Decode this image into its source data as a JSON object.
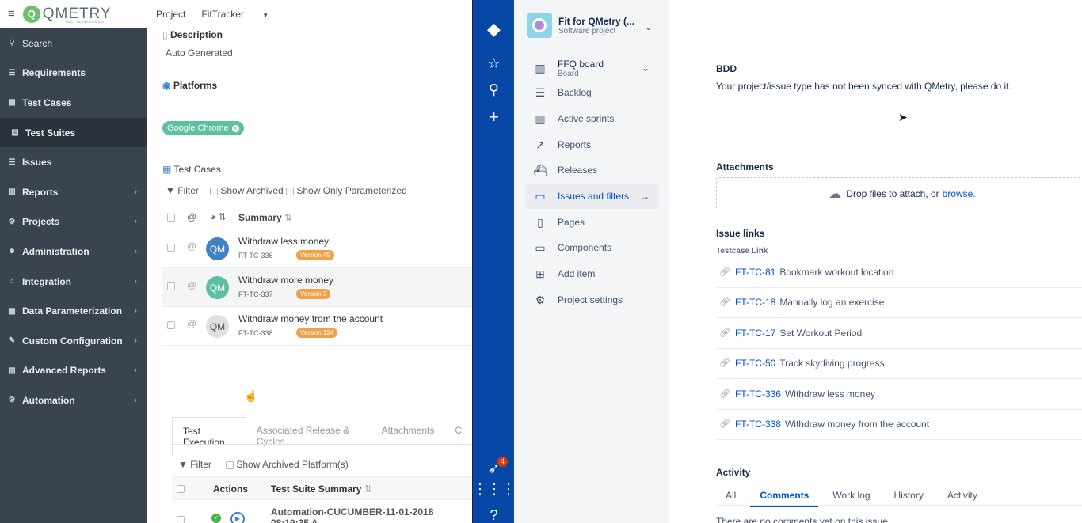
{
  "qmetry": {
    "brand": "QMETRY",
    "brand_tag": "TEST MANAGEMENT",
    "nav": [
      {
        "icon": "search-icon",
        "label": "Search",
        "chevron": false
      },
      {
        "icon": "list-icon",
        "label": "Requirements",
        "chevron": false
      },
      {
        "icon": "grid-icon",
        "label": "Test Cases",
        "chevron": false
      },
      {
        "icon": "suite-icon",
        "label": "Test Suites",
        "chevron": false,
        "active": true
      },
      {
        "icon": "list-icon",
        "label": "Issues",
        "chevron": false
      },
      {
        "icon": "chart-icon",
        "label": "Reports",
        "chevron": true
      },
      {
        "icon": "projects-icon",
        "label": "Projects",
        "chevron": true
      },
      {
        "icon": "users-icon",
        "label": "Administration",
        "chevron": true
      },
      {
        "icon": "integration-icon",
        "label": "Integration",
        "chevron": true
      },
      {
        "icon": "table-icon",
        "label": "Data Parameterization",
        "chevron": true
      },
      {
        "icon": "wrench-icon",
        "label": "Custom Configuration",
        "chevron": true
      },
      {
        "icon": "chart-icon",
        "label": "Advanced Reports",
        "chevron": true
      },
      {
        "icon": "gear-icon",
        "label": "Automation",
        "chevron": true
      }
    ],
    "topbar": {
      "project_label": "Project",
      "project_name": "FitTracker"
    },
    "description_title": "Description",
    "description_value": "Auto Generated",
    "platforms_title": "Platforms",
    "platform_chip": "Google Chrome",
    "test_cases_title": "Test Cases",
    "filter_label": "Filter",
    "show_archived": "Show Archived",
    "show_parameterized": "Show Only Parameterized",
    "summary_header": "Summary",
    "test_cases": [
      {
        "avatar": "QM",
        "title": "Withdraw less money",
        "key": "FT-TC-336",
        "version": "Version 45",
        "avatar_color": "#3e82c4"
      },
      {
        "avatar": "QM",
        "title": "Withdraw more money",
        "key": "FT-TC-337",
        "version": "Version 3",
        "avatar_color": "#5bbfa3"
      },
      {
        "avatar": "QM",
        "title": "Withdraw money from the account",
        "key": "FT-TC-338",
        "version": "Version 124",
        "avatar_color": "#d9d9d9"
      }
    ],
    "tabs": [
      "Test Execution",
      "Associated Release & Cycles",
      "Attachments",
      "C"
    ],
    "exec_filter": "Filter",
    "show_archived_platforms": "Show Archived Platform(s)",
    "exec_actions": "Actions",
    "exec_summary": "Test Suite Summary",
    "exec_row": "Automation-CUCUMBER-11-01-2018 08:19:35 A"
  },
  "jira": {
    "project_title": "Fit for QMetry (...",
    "project_sub": "Software project",
    "board_title": "FFQ board",
    "board_sub": "Board",
    "nav": [
      {
        "icon": "backlog-icon",
        "label": "Backlog"
      },
      {
        "icon": "sprints-icon",
        "label": "Active sprints"
      },
      {
        "icon": "reports-icon",
        "label": "Reports"
      },
      {
        "icon": "releases-icon",
        "label": "Releases"
      },
      {
        "icon": "issues-icon",
        "label": "Issues and filters",
        "selected": true
      },
      {
        "icon": "pages-icon",
        "label": "Pages"
      },
      {
        "icon": "components-icon",
        "label": "Components"
      },
      {
        "icon": "add-item-icon",
        "label": "Add item"
      },
      {
        "icon": "gear-icon",
        "label": "Project settings"
      }
    ],
    "notification_count": "4",
    "bdd_title": "BDD",
    "bdd_text": "Your project/issue type has not been synced with QMetry, please do it.",
    "attachments_title": "Attachments",
    "drop_text": "Drop files to attach, or",
    "browse_link": "browse.",
    "issue_links_title": "Issue links",
    "testcase_link_label": "Testcase Link",
    "links": [
      {
        "key": "FT-TC-81",
        "summary": "Bookmark workout location"
      },
      {
        "key": "FT-TC-18",
        "summary": "Manually log an exercise"
      },
      {
        "key": "FT-TC-17",
        "summary": "Set Workout Period"
      },
      {
        "key": "FT-TC-50",
        "summary": "Track skydiving progress"
      },
      {
        "key": "FT-TC-336",
        "summary": "Withdraw less money"
      },
      {
        "key": "FT-TC-338",
        "summary": "Withdraw money from the account"
      }
    ],
    "activity_title": "Activity",
    "activity_tabs": [
      "All",
      "Comments",
      "Work log",
      "History",
      "Activity"
    ],
    "no_comments": "There are no comments yet on this issue."
  }
}
